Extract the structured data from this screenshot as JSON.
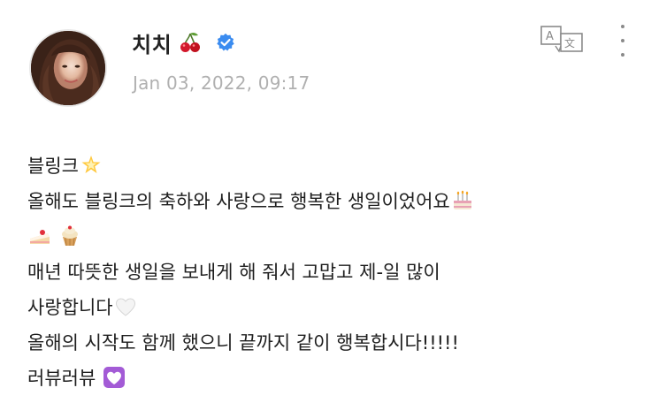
{
  "author": {
    "name": "치치",
    "name_emoji": "cherry-icon",
    "verified": true
  },
  "timestamp": "Jan 03, 2022, 09:17",
  "actions": {
    "translate_icon": "translate-icon",
    "more_icon": "more-vertical-icon"
  },
  "post": {
    "lines": [
      {
        "text": "블링크",
        "emoji": "glowing-star-icon"
      },
      {
        "text": "올해도 블링크의 축하와 사랑으로 행복한 생일이었어요",
        "emoji": "birthday-cake-icon"
      },
      {
        "text": "",
        "emoji": "shortcake-cupcake-icons"
      },
      {
        "text": "매년 따뜻한 생일을 보내게 해 줘서 고맙고 제-일 많이",
        "emoji": ""
      },
      {
        "text": "사랑합니다",
        "emoji": "white-heart-icon"
      },
      {
        "text": "올해의 시작도 함께 했으니 끝까지 같이 행복합시다!!!!!",
        "emoji": ""
      },
      {
        "text": "러뷰러뷰",
        "emoji": "heart-with-ribbon-icon"
      }
    ]
  },
  "colors": {
    "verified_blue": "#3b8cf0",
    "timestamp_gray": "#b0b0b0",
    "text": "#1e1e1e"
  }
}
